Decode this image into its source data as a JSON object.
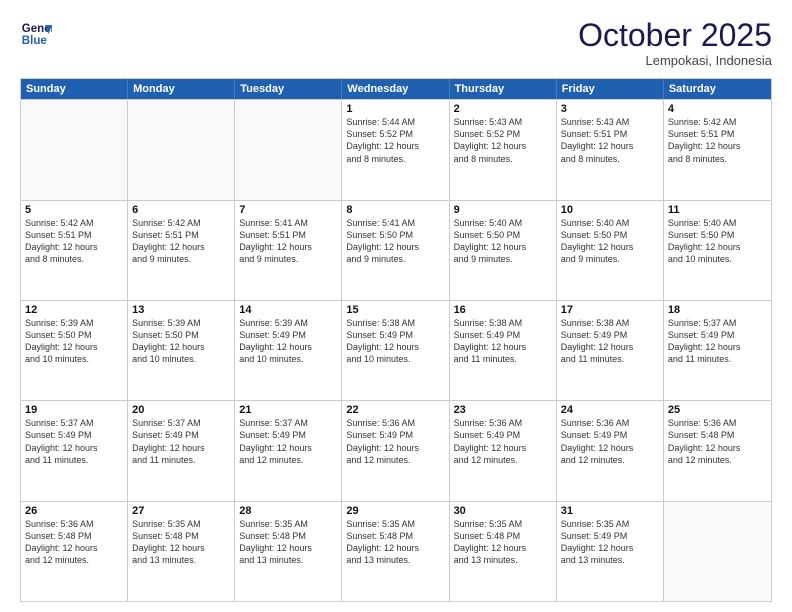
{
  "logo": {
    "line1": "General",
    "line2": "Blue"
  },
  "title": "October 2025",
  "location": "Lempokasi, Indonesia",
  "days_header": [
    "Sunday",
    "Monday",
    "Tuesday",
    "Wednesday",
    "Thursday",
    "Friday",
    "Saturday"
  ],
  "weeks": [
    [
      {
        "day": "",
        "info": ""
      },
      {
        "day": "",
        "info": ""
      },
      {
        "day": "",
        "info": ""
      },
      {
        "day": "1",
        "info": "Sunrise: 5:44 AM\nSunset: 5:52 PM\nDaylight: 12 hours\nand 8 minutes."
      },
      {
        "day": "2",
        "info": "Sunrise: 5:43 AM\nSunset: 5:52 PM\nDaylight: 12 hours\nand 8 minutes."
      },
      {
        "day": "3",
        "info": "Sunrise: 5:43 AM\nSunset: 5:51 PM\nDaylight: 12 hours\nand 8 minutes."
      },
      {
        "day": "4",
        "info": "Sunrise: 5:42 AM\nSunset: 5:51 PM\nDaylight: 12 hours\nand 8 minutes."
      }
    ],
    [
      {
        "day": "5",
        "info": "Sunrise: 5:42 AM\nSunset: 5:51 PM\nDaylight: 12 hours\nand 8 minutes."
      },
      {
        "day": "6",
        "info": "Sunrise: 5:42 AM\nSunset: 5:51 PM\nDaylight: 12 hours\nand 9 minutes."
      },
      {
        "day": "7",
        "info": "Sunrise: 5:41 AM\nSunset: 5:51 PM\nDaylight: 12 hours\nand 9 minutes."
      },
      {
        "day": "8",
        "info": "Sunrise: 5:41 AM\nSunset: 5:50 PM\nDaylight: 12 hours\nand 9 minutes."
      },
      {
        "day": "9",
        "info": "Sunrise: 5:40 AM\nSunset: 5:50 PM\nDaylight: 12 hours\nand 9 minutes."
      },
      {
        "day": "10",
        "info": "Sunrise: 5:40 AM\nSunset: 5:50 PM\nDaylight: 12 hours\nand 9 minutes."
      },
      {
        "day": "11",
        "info": "Sunrise: 5:40 AM\nSunset: 5:50 PM\nDaylight: 12 hours\nand 10 minutes."
      }
    ],
    [
      {
        "day": "12",
        "info": "Sunrise: 5:39 AM\nSunset: 5:50 PM\nDaylight: 12 hours\nand 10 minutes."
      },
      {
        "day": "13",
        "info": "Sunrise: 5:39 AM\nSunset: 5:50 PM\nDaylight: 12 hours\nand 10 minutes."
      },
      {
        "day": "14",
        "info": "Sunrise: 5:39 AM\nSunset: 5:49 PM\nDaylight: 12 hours\nand 10 minutes."
      },
      {
        "day": "15",
        "info": "Sunrise: 5:38 AM\nSunset: 5:49 PM\nDaylight: 12 hours\nand 10 minutes."
      },
      {
        "day": "16",
        "info": "Sunrise: 5:38 AM\nSunset: 5:49 PM\nDaylight: 12 hours\nand 11 minutes."
      },
      {
        "day": "17",
        "info": "Sunrise: 5:38 AM\nSunset: 5:49 PM\nDaylight: 12 hours\nand 11 minutes."
      },
      {
        "day": "18",
        "info": "Sunrise: 5:37 AM\nSunset: 5:49 PM\nDaylight: 12 hours\nand 11 minutes."
      }
    ],
    [
      {
        "day": "19",
        "info": "Sunrise: 5:37 AM\nSunset: 5:49 PM\nDaylight: 12 hours\nand 11 minutes."
      },
      {
        "day": "20",
        "info": "Sunrise: 5:37 AM\nSunset: 5:49 PM\nDaylight: 12 hours\nand 11 minutes."
      },
      {
        "day": "21",
        "info": "Sunrise: 5:37 AM\nSunset: 5:49 PM\nDaylight: 12 hours\nand 12 minutes."
      },
      {
        "day": "22",
        "info": "Sunrise: 5:36 AM\nSunset: 5:49 PM\nDaylight: 12 hours\nand 12 minutes."
      },
      {
        "day": "23",
        "info": "Sunrise: 5:36 AM\nSunset: 5:49 PM\nDaylight: 12 hours\nand 12 minutes."
      },
      {
        "day": "24",
        "info": "Sunrise: 5:36 AM\nSunset: 5:49 PM\nDaylight: 12 hours\nand 12 minutes."
      },
      {
        "day": "25",
        "info": "Sunrise: 5:36 AM\nSunset: 5:48 PM\nDaylight: 12 hours\nand 12 minutes."
      }
    ],
    [
      {
        "day": "26",
        "info": "Sunrise: 5:36 AM\nSunset: 5:48 PM\nDaylight: 12 hours\nand 12 minutes."
      },
      {
        "day": "27",
        "info": "Sunrise: 5:35 AM\nSunset: 5:48 PM\nDaylight: 12 hours\nand 13 minutes."
      },
      {
        "day": "28",
        "info": "Sunrise: 5:35 AM\nSunset: 5:48 PM\nDaylight: 12 hours\nand 13 minutes."
      },
      {
        "day": "29",
        "info": "Sunrise: 5:35 AM\nSunset: 5:48 PM\nDaylight: 12 hours\nand 13 minutes."
      },
      {
        "day": "30",
        "info": "Sunrise: 5:35 AM\nSunset: 5:48 PM\nDaylight: 12 hours\nand 13 minutes."
      },
      {
        "day": "31",
        "info": "Sunrise: 5:35 AM\nSunset: 5:49 PM\nDaylight: 12 hours\nand 13 minutes."
      },
      {
        "day": "",
        "info": ""
      }
    ]
  ]
}
